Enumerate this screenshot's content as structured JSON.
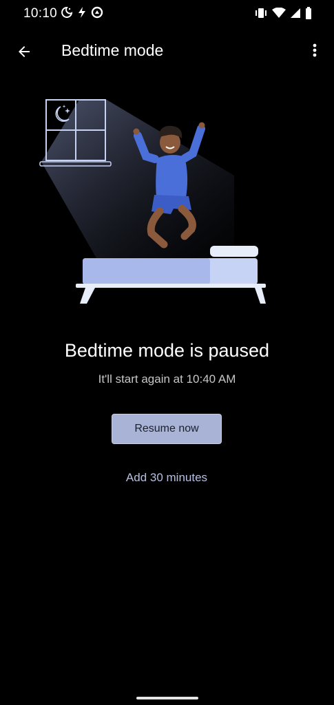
{
  "status_bar": {
    "time": "10:10",
    "icons": [
      "bedtime-moon-icon",
      "flash-icon",
      "sync-icon",
      "vibrate-icon",
      "wifi-icon",
      "signal-icon",
      "battery-icon"
    ]
  },
  "app_bar": {
    "title": "Bedtime mode",
    "back_icon": "arrow-back-icon",
    "menu_icon": "more-vert-icon"
  },
  "illustration": {
    "description_icon": "bedtime-illustration",
    "colors": {
      "accent": "#a8b3d6",
      "shirt": "#4b6fd8",
      "bed": "#c7d3f5",
      "skin": "#8b5a3c"
    }
  },
  "content": {
    "headline": "Bedtime mode is paused",
    "subtext": "It'll start again at 10:40 AM",
    "resume_label": "Resume now",
    "add_minutes_label": "Add 30 minutes"
  }
}
